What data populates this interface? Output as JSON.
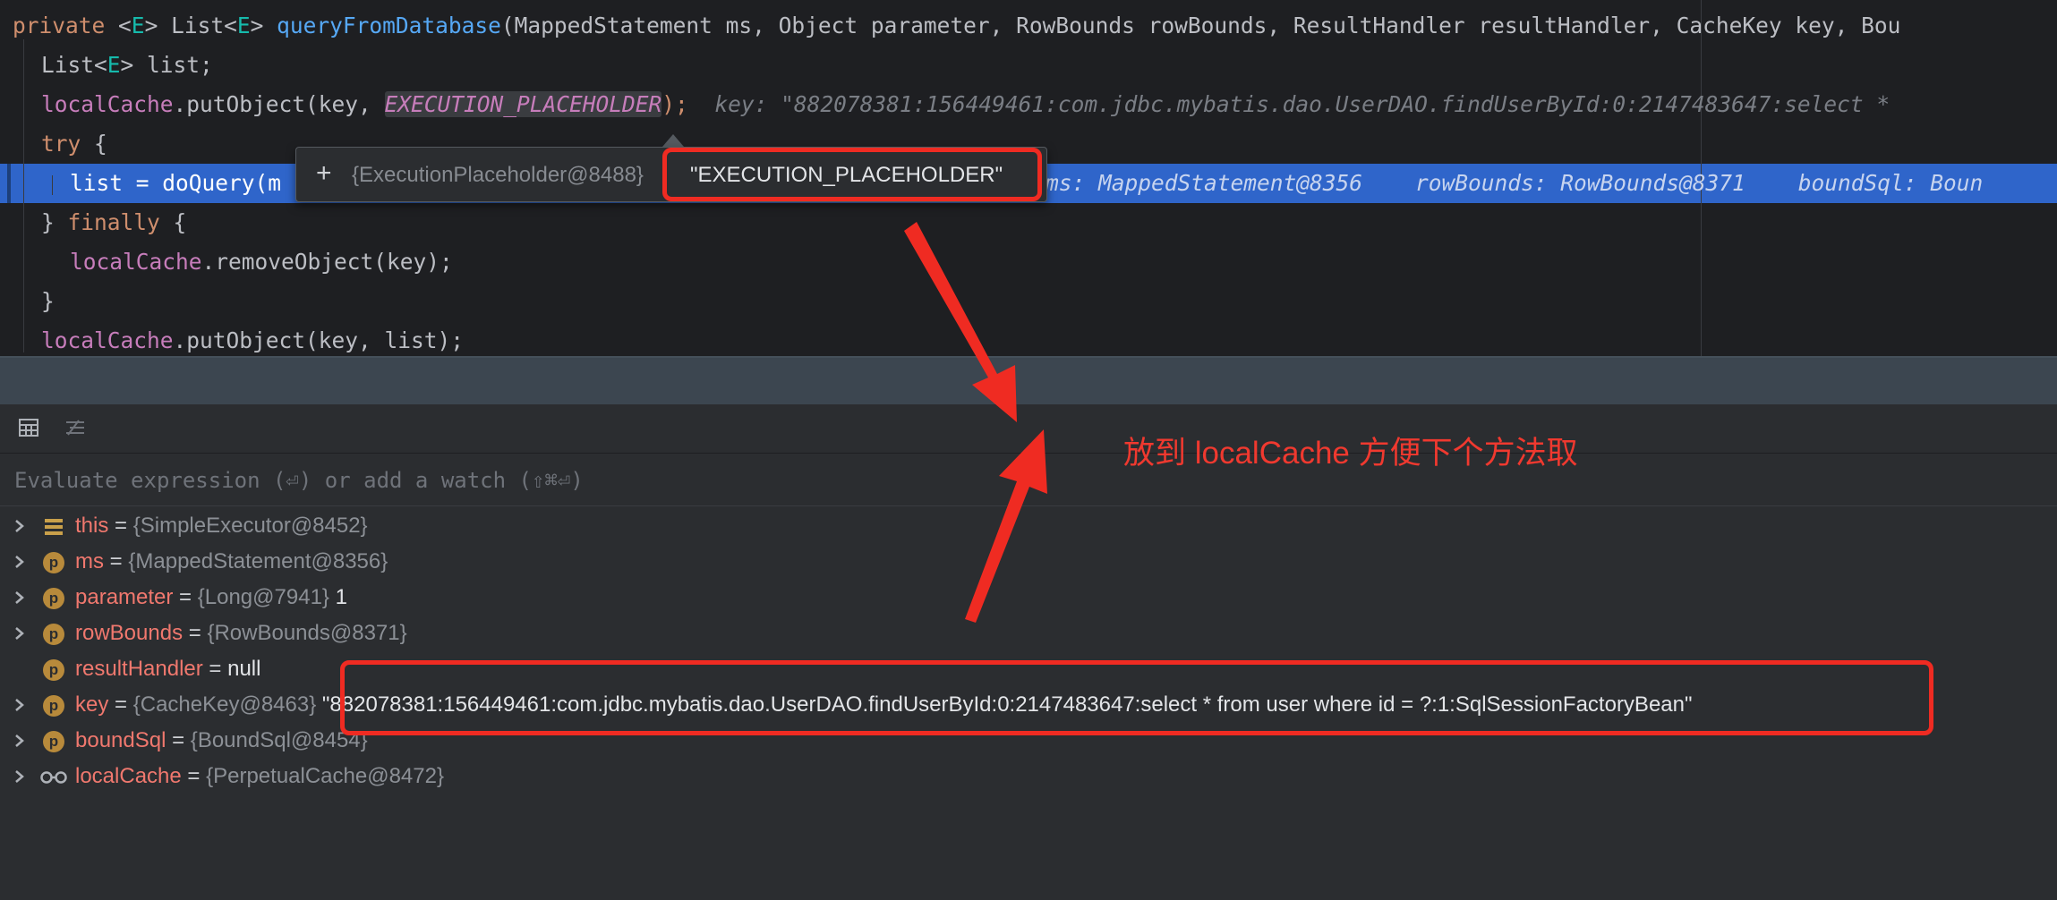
{
  "code": {
    "line1": {
      "kw": "private",
      "lt": "<",
      "t1": "E",
      "gt": "> List<",
      "t2": "E",
      "gt2": "> ",
      "method": "queryFromDatabase",
      "params": "(MappedStatement ms, Object parameter, RowBounds rowBounds, ResultHandler resultHandler, CacheKey key, Bou"
    },
    "line2": {
      "a": "List<",
      "t": "E",
      "b": "> list;"
    },
    "line3": {
      "field": "localCache",
      "call": ".putObject(key, ",
      "const": "EXECUTION_PLACEHOLDER",
      "end": ");",
      "inlay": "key: \"882078381:156449461:com.jdbc.mybatis.dao.UserDAO.findUserById:0:2147483647:select * "
    },
    "line4": {
      "kw": "try",
      "rest": " {"
    },
    "line5": {
      "text": "list = doQuery(m",
      "inlay": "ms: MappedStatement@8356    rowBounds: RowBounds@8371    boundSql: Boun"
    },
    "line6": {
      "open": "} ",
      "kw": "finally",
      "rest": " {"
    },
    "line7": {
      "field": "localCache",
      "call": ".removeObject(key);"
    },
    "line8": {
      "text": "}"
    },
    "line9": {
      "field": "localCache",
      "call": ".putObject(key, list);"
    }
  },
  "popup": {
    "expand": "+",
    "object": "{ExecutionPlaceholder@8488}",
    "value": "\"EXECUTION_PLACEHOLDER\""
  },
  "debugger": {
    "eval_placeholder": "Evaluate expression (⏎) or add a watch (⇧⌘⏎)",
    "variables": [
      {
        "name": "this",
        "eq": " = ",
        "obj": "{SimpleExecutor@8452}",
        "val": ""
      },
      {
        "name": "ms",
        "eq": " = ",
        "obj": "{MappedStatement@8356}",
        "val": ""
      },
      {
        "name": "parameter",
        "eq": " = ",
        "obj": "{Long@7941}",
        "val": " 1"
      },
      {
        "name": "rowBounds",
        "eq": " = ",
        "obj": "{RowBounds@8371}",
        "val": ""
      },
      {
        "name": "resultHandler",
        "eq": " = ",
        "obj": "",
        "val": "null"
      },
      {
        "name": "key",
        "eq": " = ",
        "obj": "{CacheKey@8463}",
        "val": " \"882078381:156449461:com.jdbc.mybatis.dao.UserDAO.findUserById:0:2147483647:select * from user where id = ?:1:SqlSessionFactoryBean\""
      },
      {
        "name": "boundSql",
        "eq": " = ",
        "obj": "{BoundSql@8454}",
        "val": ""
      },
      {
        "name": "localCache",
        "eq": " = ",
        "obj": "{PerpetualCache@8472}",
        "val": ""
      }
    ]
  },
  "annotation": "放到 localCache 方便下个方法取",
  "colors": {
    "annotation_red": "#ef2b22",
    "highlight_blue": "#2f65ca",
    "badge": "#b88a3b"
  }
}
